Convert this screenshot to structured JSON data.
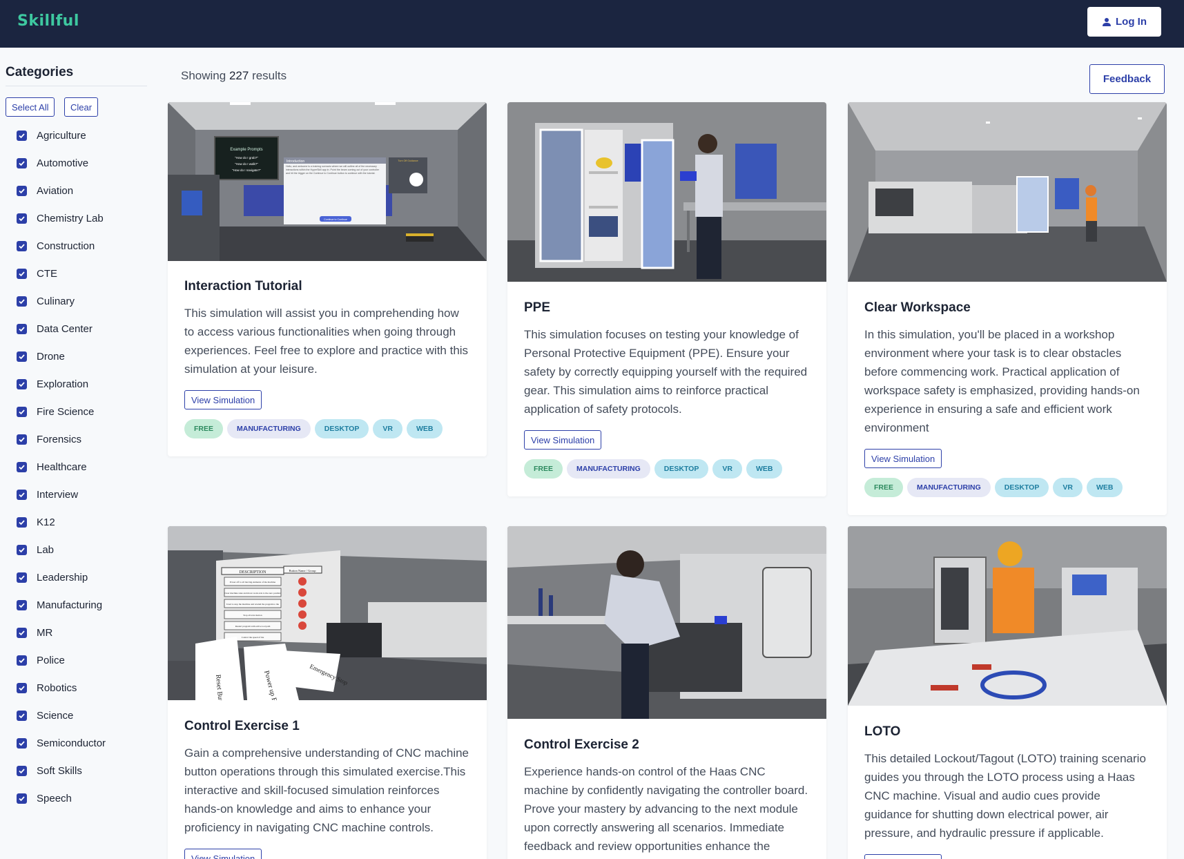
{
  "header": {
    "logo_text": "Skillful",
    "login_label": "Log In",
    "user_icon": "user-icon"
  },
  "sidebar": {
    "title": "Categories",
    "select_all_label": "Select All",
    "clear_label": "Clear",
    "items": [
      {
        "label": "Agriculture",
        "checked": true
      },
      {
        "label": "Automotive",
        "checked": true
      },
      {
        "label": "Aviation",
        "checked": true
      },
      {
        "label": "Chemistry Lab",
        "checked": true
      },
      {
        "label": "Construction",
        "checked": true
      },
      {
        "label": "CTE",
        "checked": true
      },
      {
        "label": "Culinary",
        "checked": true
      },
      {
        "label": "Data Center",
        "checked": true
      },
      {
        "label": "Drone",
        "checked": true
      },
      {
        "label": "Exploration",
        "checked": true
      },
      {
        "label": "Fire Science",
        "checked": true
      },
      {
        "label": "Forensics",
        "checked": true
      },
      {
        "label": "Healthcare",
        "checked": true
      },
      {
        "label": "Interview",
        "checked": true
      },
      {
        "label": "K12",
        "checked": true
      },
      {
        "label": "Lab",
        "checked": true
      },
      {
        "label": "Leadership",
        "checked": true
      },
      {
        "label": "Manufacturing",
        "checked": true
      },
      {
        "label": "MR",
        "checked": true
      },
      {
        "label": "Police",
        "checked": true
      },
      {
        "label": "Robotics",
        "checked": true
      },
      {
        "label": "Science",
        "checked": true
      },
      {
        "label": "Semiconductor",
        "checked": true
      },
      {
        "label": "Soft Skills",
        "checked": true
      },
      {
        "label": "Speech",
        "checked": true
      }
    ]
  },
  "main": {
    "results_prefix": "Showing",
    "results_count": "227",
    "results_suffix": "results",
    "feedback_label": "Feedback",
    "view_label": "View Simulation",
    "tags": [
      "FREE",
      "MANUFACTURING",
      "DESKTOP",
      "VR",
      "WEB"
    ],
    "cards": [
      {
        "title": "Interaction Tutorial",
        "description": "This simulation will assist you in comprehending how to access various functionalities when going through experiences. Feel free to explore and practice with this simulation at your leisure.",
        "screen_title": "Example Prompts",
        "screen_prompts": [
          "\"How do I grab?\"",
          "\"How do I walk?\"",
          "\"How do I navigate?\""
        ],
        "panel_title": "Introduction",
        "panel_text": "Hello, and welcome to a training scenario where we will outline all of the necessary interactions within the HyperSkill app in. Point the beam coming out of your controller and hit the trigger on the Continue to Continue button to continue with the tutorial.",
        "panel_button": "Continue to Continue",
        "side_label": "Turn Off Guidance"
      },
      {
        "title": "PPE",
        "description": "This simulation focuses on testing your knowledge of Personal Protective Equipment (PPE). Ensure your safety by correctly equipping yourself with the required gear. This simulation aims to reinforce practical application of safety protocols."
      },
      {
        "title": "Clear Workspace",
        "description": "In this simulation, you'll be placed in a workshop environment where your task is to clear obstacles before commencing work. Practical application of workspace safety is emphasized, providing hands-on experience in ensuring a safe and efficient work environment"
      },
      {
        "title": "Control Exercise 1",
        "description": "Gain a comprehensive understanding of CNC machine button operations through this simulated exercise.This interactive and skill-focused simulation reinforces hands-on knowledge and aims to enhance your proficiency in navigating CNC machine controls.",
        "board_headers": [
          "DESCRIPTION",
          "Button Name / Group"
        ],
        "board_rows": [
          "Power off to all moving elements of the machine",
          "Clear machine state and move work axis to the zero position",
          "Used to stop the machine and rewind the program to the",
          "Stop all axis motion",
          "Restart program with active tool path",
          "Control the speed of the"
        ],
        "floor_cards": [
          "Emergency Stop",
          "Power up Restart",
          "Reset Button"
        ]
      },
      {
        "title": "Control Exercise 2",
        "description": "Experience hands-on control of the Haas CNC machine by confidently navigating the controller board. Prove your mastery by advancing to the next module upon correctly answering all scenarios. Immediate feedback and review opportunities enhance the learning experience."
      },
      {
        "title": "LOTO",
        "description": "This detailed Lockout/Tagout (LOTO) training scenario guides you through the LOTO process using a Haas CNC machine. Visual and audio cues provide guidance for shutting down electrical power, air pressure, and hydraulic pressure if applicable."
      }
    ]
  },
  "colors": {
    "header_bg": "#1b2540",
    "accent": "#2c3fa8",
    "logo": "#3ec8a0"
  }
}
